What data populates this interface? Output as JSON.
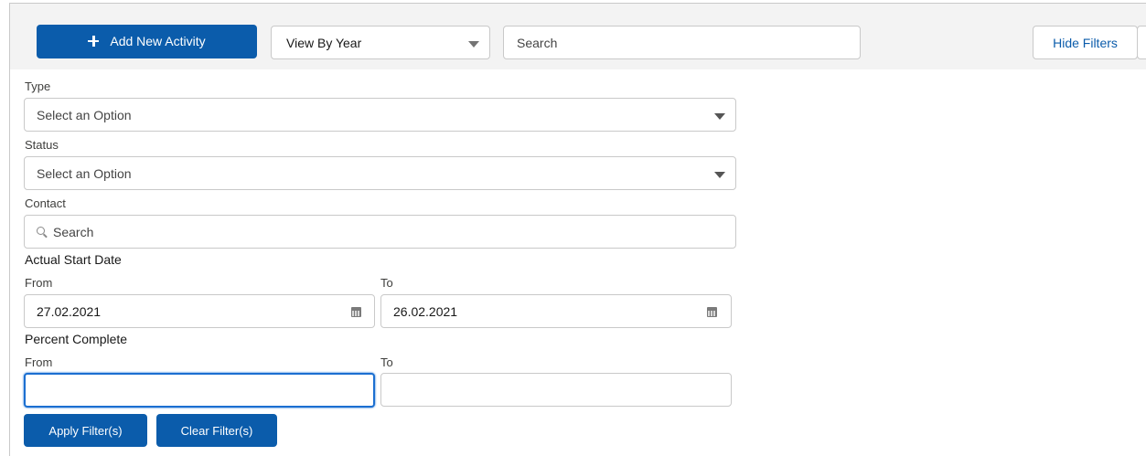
{
  "toolbar": {
    "add_label": "Add New Activity",
    "add_icon": "plus-icon",
    "view_select": {
      "value": "View By Year",
      "icon": "chevron-down-icon"
    },
    "search_placeholder": "Search",
    "hide_filters_label": "Hide Filters"
  },
  "filters": {
    "type": {
      "label": "Type",
      "placeholder": "Select an Option"
    },
    "status": {
      "label": "Status",
      "placeholder": "Select an Option"
    },
    "contact": {
      "label": "Contact",
      "placeholder": "Search",
      "icon": "search-icon"
    },
    "actual_start_date": {
      "label": "Actual Start Date",
      "from_label": "From",
      "from_value": "27.02.2021",
      "to_label": "To",
      "to_value": "26.02.2021",
      "icon": "calendar-icon"
    },
    "percent_complete": {
      "label": "Percent Complete",
      "from_label": "From",
      "from_value": "",
      "to_label": "To",
      "to_value": ""
    }
  },
  "actions": {
    "apply_label": "Apply Filter(s)",
    "clear_label": "Clear Filter(s)"
  },
  "colors": {
    "brand": "#0b5cab",
    "focus": "#1b6fd1",
    "toolbar_bg": "#f3f3f3"
  }
}
